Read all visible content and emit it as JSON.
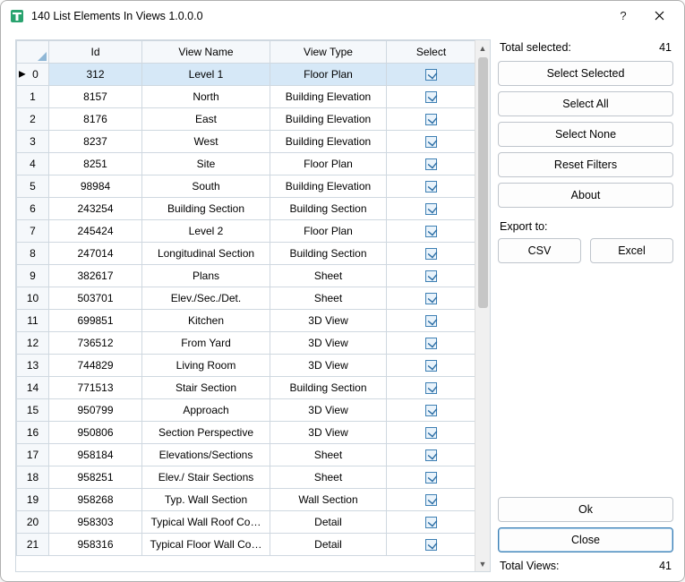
{
  "window": {
    "title": "140 List Elements In Views 1.0.0.0"
  },
  "grid": {
    "headers": {
      "id": "Id",
      "view_name": "View Name",
      "view_type": "View Type",
      "select": "Select"
    },
    "rows": [
      {
        "n": "0",
        "id": "312",
        "name": "Level 1",
        "type": "Floor Plan",
        "sel": true,
        "active": true
      },
      {
        "n": "1",
        "id": "8157",
        "name": "North",
        "type": "Building Elevation",
        "sel": true
      },
      {
        "n": "2",
        "id": "8176",
        "name": "East",
        "type": "Building Elevation",
        "sel": true
      },
      {
        "n": "3",
        "id": "8237",
        "name": "West",
        "type": "Building Elevation",
        "sel": true
      },
      {
        "n": "4",
        "id": "8251",
        "name": "Site",
        "type": "Floor Plan",
        "sel": true
      },
      {
        "n": "5",
        "id": "98984",
        "name": "South",
        "type": "Building Elevation",
        "sel": true
      },
      {
        "n": "6",
        "id": "243254",
        "name": "Building Section",
        "type": "Building Section",
        "sel": true
      },
      {
        "n": "7",
        "id": "245424",
        "name": "Level 2",
        "type": "Floor Plan",
        "sel": true
      },
      {
        "n": "8",
        "id": "247014",
        "name": "Longitudinal Section",
        "type": "Building Section",
        "sel": true
      },
      {
        "n": "9",
        "id": "382617",
        "name": "Plans",
        "type": "Sheet",
        "sel": true
      },
      {
        "n": "10",
        "id": "503701",
        "name": "Elev./Sec./Det.",
        "type": "Sheet",
        "sel": true
      },
      {
        "n": "11",
        "id": "699851",
        "name": "Kitchen",
        "type": "3D View",
        "sel": true
      },
      {
        "n": "12",
        "id": "736512",
        "name": "From Yard",
        "type": "3D View",
        "sel": true
      },
      {
        "n": "13",
        "id": "744829",
        "name": "Living Room",
        "type": "3D View",
        "sel": true
      },
      {
        "n": "14",
        "id": "771513",
        "name": "Stair Section",
        "type": "Building Section",
        "sel": true
      },
      {
        "n": "15",
        "id": "950799",
        "name": "Approach",
        "type": "3D View",
        "sel": true
      },
      {
        "n": "16",
        "id": "950806",
        "name": "Section Perspective",
        "type": "3D View",
        "sel": true
      },
      {
        "n": "17",
        "id": "958184",
        "name": "Elevations/Sections",
        "type": "Sheet",
        "sel": true
      },
      {
        "n": "18",
        "id": "958251",
        "name": "Elev./ Stair Sections",
        "type": "Sheet",
        "sel": true
      },
      {
        "n": "19",
        "id": "958268",
        "name": "Typ. Wall Section",
        "type": "Wall Section",
        "sel": true
      },
      {
        "n": "20",
        "id": "958303",
        "name": "Typical Wall Roof Co…",
        "type": "Detail",
        "sel": true
      },
      {
        "n": "21",
        "id": "958316",
        "name": "Typical Floor Wall Co…",
        "type": "Detail",
        "sel": true
      }
    ]
  },
  "side": {
    "total_selected_label": "Total selected:",
    "total_selected_value": "41",
    "buttons": {
      "select_selected": "Select Selected",
      "select_all": "Select All",
      "select_none": "Select None",
      "reset_filters": "Reset Filters",
      "about": "About",
      "ok": "Ok",
      "close": "Close"
    },
    "export_label": "Export to:",
    "export_csv": "CSV",
    "export_excel": "Excel",
    "total_views_label": "Total Views:",
    "total_views_value": "41"
  }
}
